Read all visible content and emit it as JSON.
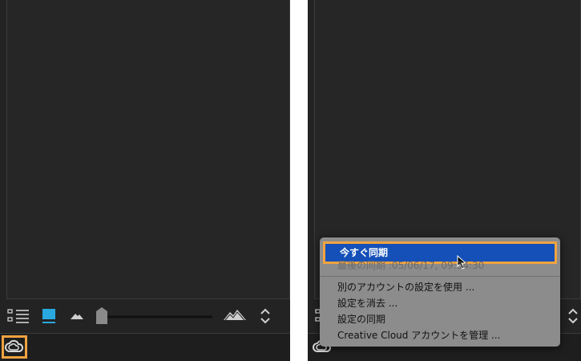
{
  "colors": {
    "highlight": "#f0a340",
    "selection": "#1450b8",
    "accent": "#29a8e0",
    "panel": "#262626",
    "menu_bg": "#8c8c8c"
  },
  "toolbar": {
    "list_view_icon": "list-view-icon",
    "grid_view_icon": "grid-view-icon",
    "small_mountain_icon": "small-mountain-icon",
    "large_mountain_icon": "large-mountain-icon",
    "sort_icon": "chevron-updown-icon",
    "thumbnail_size": 0.05
  },
  "bottombar": {
    "cc_icon": "creative-cloud-icon"
  },
  "menu": {
    "sync_now": "今すぐ同期",
    "last_sync": "最後の同期 :05/06/17, 09:54:30",
    "use_other_account": "別のアカウントの設定を使用 ...",
    "clear_settings": "設定を消去 ...",
    "sync_settings": "設定の同期",
    "manage_account": "Creative Cloud アカウントを管理 ..."
  }
}
